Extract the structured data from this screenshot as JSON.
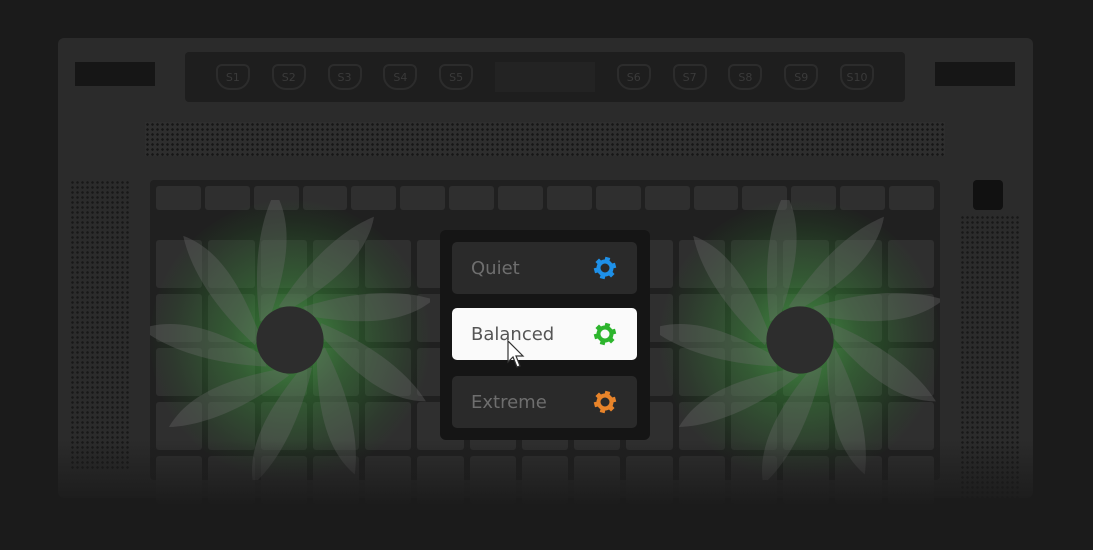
{
  "top_keys": [
    "S1",
    "S2",
    "S3",
    "S4",
    "S5",
    "S6",
    "S7",
    "S8",
    "S9",
    "S10"
  ],
  "fan_modes": [
    {
      "label": "Quiet",
      "icon": "gear-icon",
      "color": "#1e90e8",
      "selected": false
    },
    {
      "label": "Balanced",
      "icon": "gear-icon",
      "color": "#2db52d",
      "selected": true
    },
    {
      "label": "Extreme",
      "icon": "gear-icon",
      "color": "#e8842a",
      "selected": false
    }
  ]
}
